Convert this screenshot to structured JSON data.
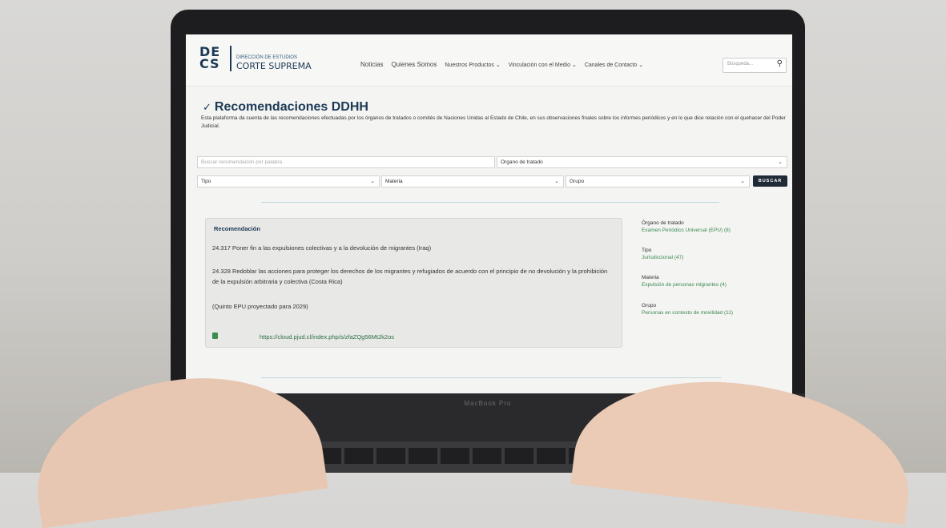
{
  "logo": {
    "letters_top": "DE",
    "letters_bottom": "CS",
    "small": "DIRECCIÓN DE ESTUDIOS",
    "big": "CORTE SUPREMA"
  },
  "nav": {
    "items": [
      "Noticias",
      "Quienes Somos",
      "Nuestros Productos",
      "Vinculación con el Medio",
      "Canales de Contacto"
    ]
  },
  "search": {
    "placeholder": "Búsqueda..."
  },
  "page": {
    "title": "Recomendaciones DDHH",
    "description": "Esta plataforma da cuenta de las recomendaciones efectuadas por los órganos de tratados o comités de Naciones Unidas al Estado de Chile, en sus observaciones finales sobre los informes periódicos y en lo que dice relación con el quehacer del Poder Judicial."
  },
  "filters": {
    "keyword_placeholder": "Buscar recomendación por palabra",
    "organo": "Organo de tratado",
    "tipo": "Tipo",
    "materia": "Materia",
    "grupo": "Grupo",
    "button": "BUSCAR"
  },
  "result": {
    "label": "Recomendación",
    "p1": "24.317 Poner fin a las expulsiones colectivas y a la devolución de migrantes (Iraq)",
    "p2": "24.328 Redoblar las acciones para proteger los derechos de los migrantes y refugiados de acuerdo con el principio de no devolución y la prohibición de la expulsión arbitraria y colectiva (Costa Rica)",
    "p3": "(Quinto EPU proyectado para 2029)",
    "link": "https://cloud.pjud.cl/index.php/s/zfaZQg56Mt2k2os"
  },
  "facets": [
    {
      "heading": "Órgano de tratado",
      "value": "Examen Periódico Universal (EPU) (8)"
    },
    {
      "heading": "Tipo",
      "value": "Jurisdiccional (47)"
    },
    {
      "heading": "Materia",
      "value": "Expulsión de personas migrantes (4)"
    },
    {
      "heading": "Grupo",
      "value": "Personas en contexto de movilidad (11)"
    }
  ],
  "laptop": {
    "brand": "MacBook Pro"
  },
  "colors": {
    "brand": "#1c3a55",
    "link": "#3b8a4e",
    "button": "#1f2a37"
  }
}
